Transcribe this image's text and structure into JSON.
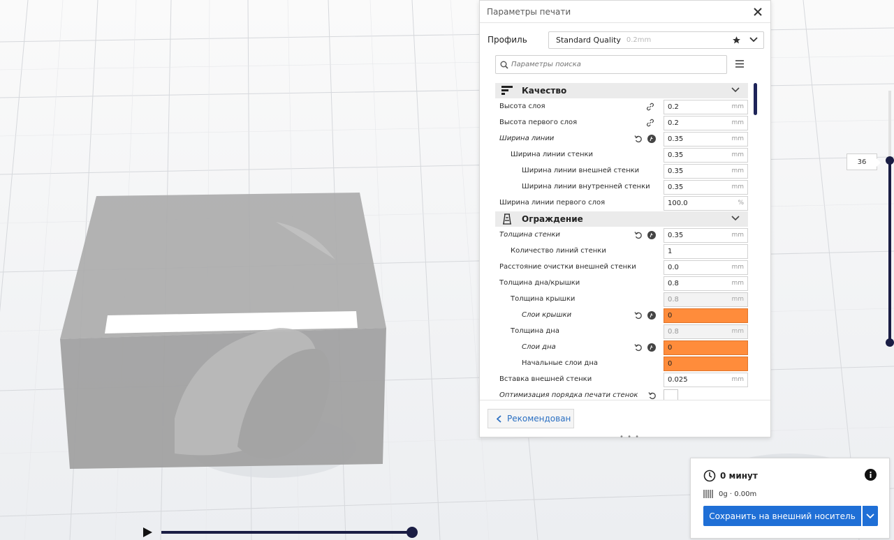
{
  "panel": {
    "title": "Параметры печати",
    "profile_label": "Профиль",
    "profile_name": "Standard Quality",
    "profile_sub": "0.2mm",
    "search_placeholder": "Параметры поиска",
    "recommended_button": "Рекомендован",
    "drag_handle": "• • •"
  },
  "categories": [
    {
      "label": "Качество",
      "icon": "quality-icon"
    },
    {
      "label": "Ограждение",
      "icon": "walls-icon"
    }
  ],
  "rows_quality": [
    {
      "label": "Высота слоя",
      "value": "0.2",
      "unit": "mm",
      "indent": 0,
      "italic": false,
      "icons": [
        "link"
      ],
      "state": "normal"
    },
    {
      "label": "Высота первого слоя",
      "value": "0.2",
      "unit": "mm",
      "indent": 0,
      "italic": false,
      "icons": [
        "link"
      ],
      "state": "normal"
    },
    {
      "label": "Ширина линии",
      "value": "0.35",
      "unit": "mm",
      "indent": 0,
      "italic": true,
      "icons": [
        "reset",
        "fx"
      ],
      "state": "normal"
    },
    {
      "label": "Ширина линии стенки",
      "value": "0.35",
      "unit": "mm",
      "indent": 1,
      "italic": false,
      "icons": [],
      "state": "normal"
    },
    {
      "label": "Ширина линии внешней стенки",
      "value": "0.35",
      "unit": "mm",
      "indent": 2,
      "italic": false,
      "icons": [],
      "state": "normal"
    },
    {
      "label": "Ширина линии внутренней стенки",
      "value": "0.35",
      "unit": "mm",
      "indent": 2,
      "italic": false,
      "icons": [],
      "state": "normal"
    },
    {
      "label": "Ширина линии первого слоя",
      "value": "100.0",
      "unit": "%",
      "indent": 0,
      "italic": false,
      "icons": [],
      "state": "normal"
    }
  ],
  "rows_walls": [
    {
      "label": "Толщина стенки",
      "value": "0.35",
      "unit": "mm",
      "indent": 0,
      "italic": true,
      "icons": [
        "reset",
        "fx"
      ],
      "state": "normal"
    },
    {
      "label": "Количество линий стенки",
      "value": "1",
      "unit": "",
      "indent": 1,
      "italic": false,
      "icons": [],
      "state": "normal"
    },
    {
      "label": "Расстояние очистки внешней стенки",
      "value": "0.0",
      "unit": "mm",
      "indent": 0,
      "italic": false,
      "icons": [],
      "state": "normal"
    },
    {
      "label": "Толщина дна/крышки",
      "value": "0.8",
      "unit": "mm",
      "indent": 0,
      "italic": false,
      "icons": [],
      "state": "normal"
    },
    {
      "label": "Толщина крышки",
      "value": "0.8",
      "unit": "mm",
      "indent": 1,
      "italic": false,
      "icons": [],
      "state": "readonly"
    },
    {
      "label": "Слои крышки",
      "value": "0",
      "unit": "",
      "indent": 2,
      "italic": true,
      "icons": [
        "reset",
        "fx"
      ],
      "state": "error"
    },
    {
      "label": "Толщина дна",
      "value": "0.8",
      "unit": "mm",
      "indent": 1,
      "italic": false,
      "icons": [],
      "state": "readonly"
    },
    {
      "label": "Слои дна",
      "value": "0",
      "unit": "",
      "indent": 2,
      "italic": true,
      "icons": [
        "reset",
        "fx"
      ],
      "state": "error"
    },
    {
      "label": "Начальные слои дна",
      "value": "0",
      "unit": "",
      "indent": 2,
      "italic": false,
      "icons": [],
      "state": "error"
    },
    {
      "label": "Вставка внешней стенки",
      "value": "0.025",
      "unit": "mm",
      "indent": 0,
      "italic": false,
      "icons": [],
      "state": "normal"
    },
    {
      "label": "Оптимизация порядка печати стенок",
      "value": "",
      "unit": "",
      "indent": 0,
      "italic": true,
      "icons": [
        "reset-only"
      ],
      "state": "checkbox"
    }
  ],
  "layer": {
    "value": "36"
  },
  "output": {
    "time": "0 минут",
    "material": "0g · 0.00m",
    "save_button": "Сохранить на внешний носитель"
  },
  "colors": {
    "accent": "#1f6fd6",
    "dark_navy": "#1a1d44",
    "error_orange": "#ff8c3b"
  }
}
